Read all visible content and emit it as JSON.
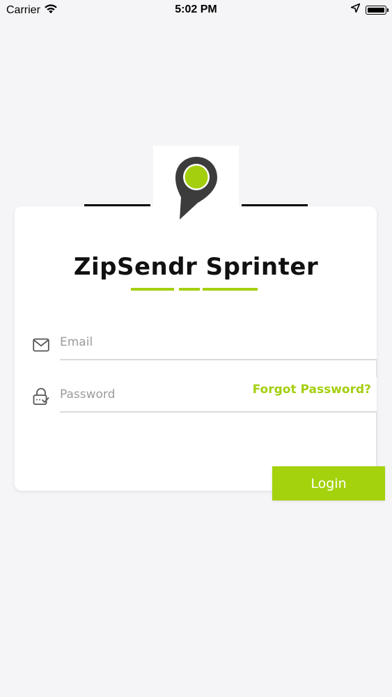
{
  "status_bar": {
    "carrier": "Carrier",
    "time": "5:02 PM",
    "icons": [
      "wifi-icon",
      "location-arrow-icon",
      "battery-icon"
    ]
  },
  "app": {
    "title": "ZipSendr Sprinter",
    "logo_icon": "map-pin-icon"
  },
  "form": {
    "email": {
      "icon": "envelope-icon",
      "placeholder": "Email",
      "value": ""
    },
    "password": {
      "icon": "lock-icon",
      "placeholder": "Password",
      "value": ""
    },
    "forgot_password_label": "Forgot Password?",
    "login_label": "Login"
  },
  "colors": {
    "accent": "#a4cf0f",
    "background": "#f5f5f7",
    "card": "#ffffff",
    "title_text": "#111111",
    "logo_pin": "#3c3c3c"
  }
}
